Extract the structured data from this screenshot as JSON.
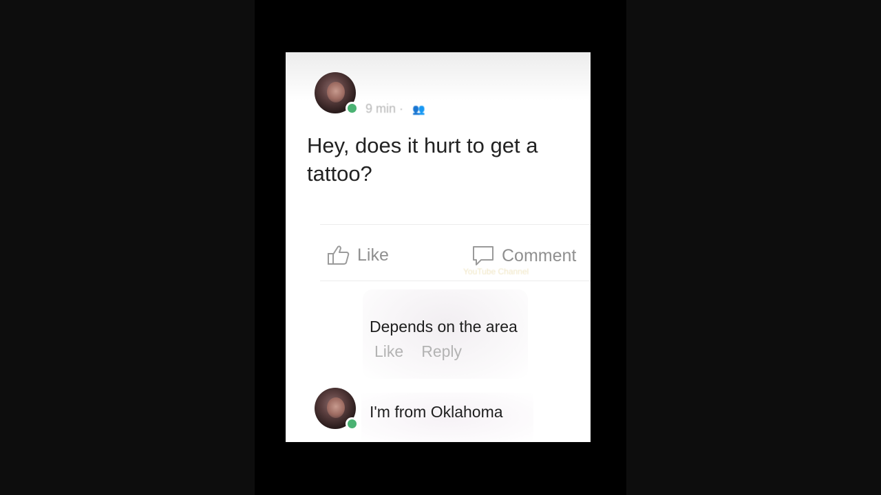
{
  "post": {
    "time": "9 min",
    "audience_icon": "friends-icon",
    "text": "Hey, does it hurt to get a tattoo?"
  },
  "actions": {
    "like_label": "Like",
    "comment_label": "Comment"
  },
  "watermark": "YouTube Channel",
  "comments": [
    {
      "text": "Depends on the area",
      "like_label": "Like",
      "reply_label": "Reply"
    },
    {
      "text": "I'm from Oklahoma"
    }
  ],
  "colors": {
    "online_dot": "#4bb273",
    "card_background": "#ffffff",
    "page_background": "#000000"
  }
}
